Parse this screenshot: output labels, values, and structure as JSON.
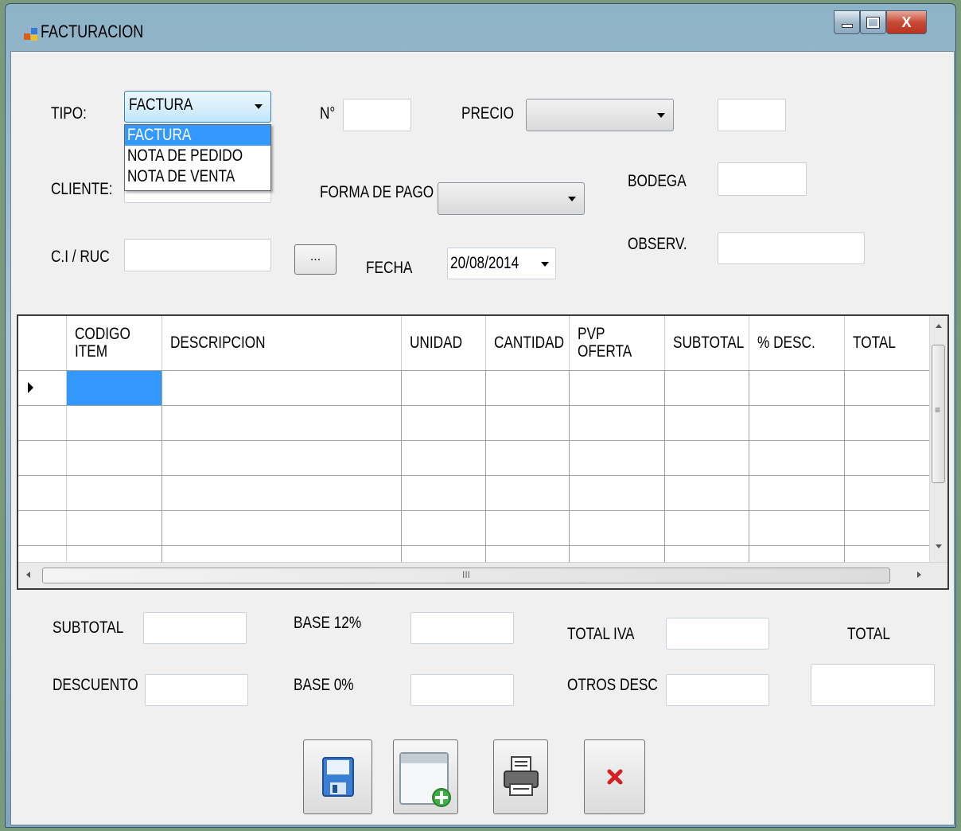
{
  "window": {
    "title": "FACTURACION",
    "controls": {
      "minimize": "–",
      "maximize": "□",
      "close": "X"
    }
  },
  "form": {
    "tipo_label": "TIPO:",
    "tipo_value": "FACTURA",
    "tipo_options": [
      "FACTURA",
      "NOTA DE PEDIDO",
      "NOTA DE VENTA"
    ],
    "numero_label": "N°",
    "precio_label": "PRECIO",
    "cliente_label": "CLIENTE:",
    "forma_pago_label": "FORMA DE PAGO",
    "bodega_label": "BODEGA",
    "ci_ruc_label": "C.I / RUC",
    "browse_button": "...",
    "fecha_label": "FECHA",
    "fecha_value": "20/08/2014",
    "observ_label": "OBSERV."
  },
  "grid": {
    "columns": [
      "CODIGO ITEM",
      "DESCRIPCION",
      "UNIDAD",
      "CANTIDAD",
      "PVP OFERTA",
      "SUBTOTAL",
      "% DESC.",
      "TOTAL"
    ],
    "row_count": 6,
    "hscroll_grip": "III",
    "vscroll_grip": "≡"
  },
  "totals": {
    "subtotal_label": "SUBTOTAL",
    "base12_label": "BASE 12%",
    "total_iva_label": "TOTAL IVA",
    "total_label": "TOTAL",
    "descuento_label": "DESCUENTO",
    "base0_label": "BASE 0%",
    "otros_desc_label": "OTROS DESC"
  },
  "actions": [
    {
      "name": "save",
      "icon": "floppy-disk-icon"
    },
    {
      "name": "new",
      "icon": "window-add-icon"
    },
    {
      "name": "print",
      "icon": "printer-icon"
    },
    {
      "name": "cancel",
      "icon": "red-x-icon"
    }
  ],
  "colors": {
    "selection": "#3399ff",
    "accent_green": "#3cb043",
    "cancel_red": "#d42020"
  }
}
